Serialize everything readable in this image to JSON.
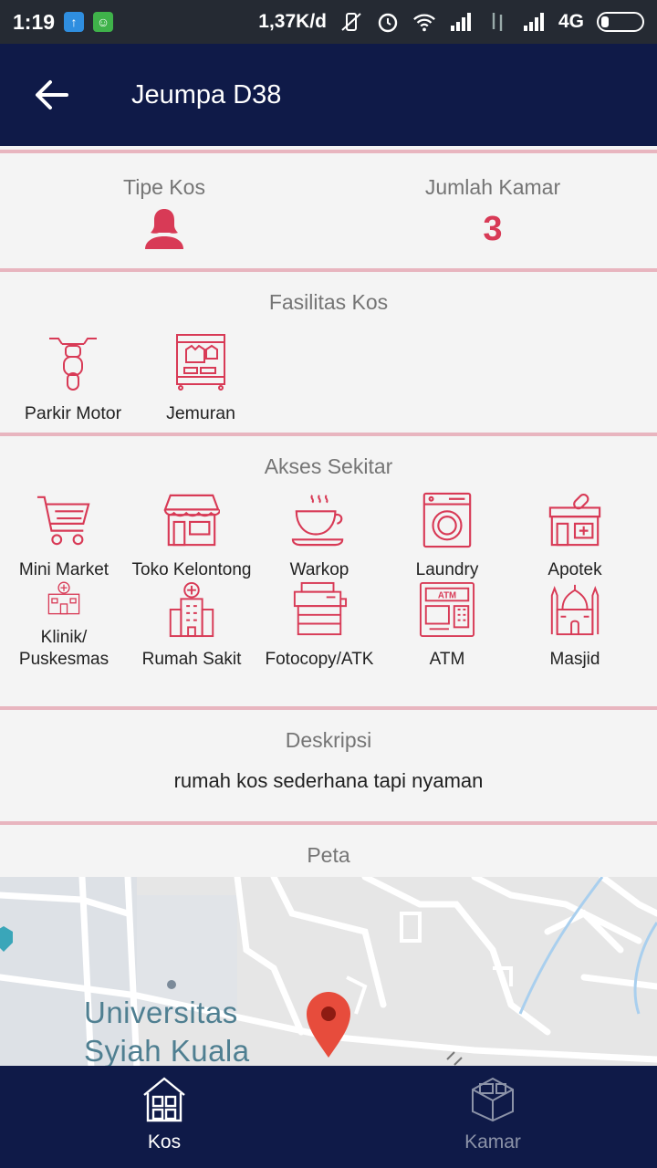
{
  "status_bar": {
    "time": "1:19",
    "speed": "1,37K/d",
    "network": "4G"
  },
  "header": {
    "title": "Jeumpa D38"
  },
  "info": {
    "type_label": "Tipe Kos",
    "type_icon": "female-user-icon",
    "rooms_label": "Jumlah Kamar",
    "rooms_value": "3"
  },
  "facilities": {
    "title": "Fasilitas Kos",
    "items": [
      {
        "label": "Parkir Motor",
        "icon": "motorcycle-icon"
      },
      {
        "label": "Jemuran",
        "icon": "clothes-rack-icon"
      }
    ]
  },
  "access": {
    "title": "Akses Sekitar",
    "items": [
      {
        "label": "Mini Market",
        "icon": "shopping-cart-icon"
      },
      {
        "label": "Toko Kelontong",
        "icon": "store-icon"
      },
      {
        "label": "Warkop",
        "icon": "coffee-cup-icon"
      },
      {
        "label": "Laundry",
        "icon": "washing-machine-icon"
      },
      {
        "label": "Apotek",
        "icon": "pharmacy-icon"
      },
      {
        "label": "Klinik/ Puskesmas",
        "icon": "clinic-icon"
      },
      {
        "label": "Rumah Sakit",
        "icon": "hospital-icon"
      },
      {
        "label": "Fotocopy/ATK",
        "icon": "photocopier-icon"
      },
      {
        "label": "ATM",
        "icon": "atm-icon"
      },
      {
        "label": "Masjid",
        "icon": "mosque-icon"
      }
    ]
  },
  "description": {
    "title": "Deskripsi",
    "text": "rumah kos sederhana tapi nyaman"
  },
  "map": {
    "title": "Peta",
    "place_line1": "Universitas",
    "place_line2": "Syiah Kuala"
  },
  "bottom_nav": {
    "items": [
      {
        "label": "Kos",
        "icon": "house-icon",
        "active": true
      },
      {
        "label": "Kamar",
        "icon": "cube-room-icon",
        "active": false
      }
    ]
  },
  "colors": {
    "primary": "#0f1a48",
    "accent": "#d83a56",
    "divider": "#e8b5bf"
  }
}
